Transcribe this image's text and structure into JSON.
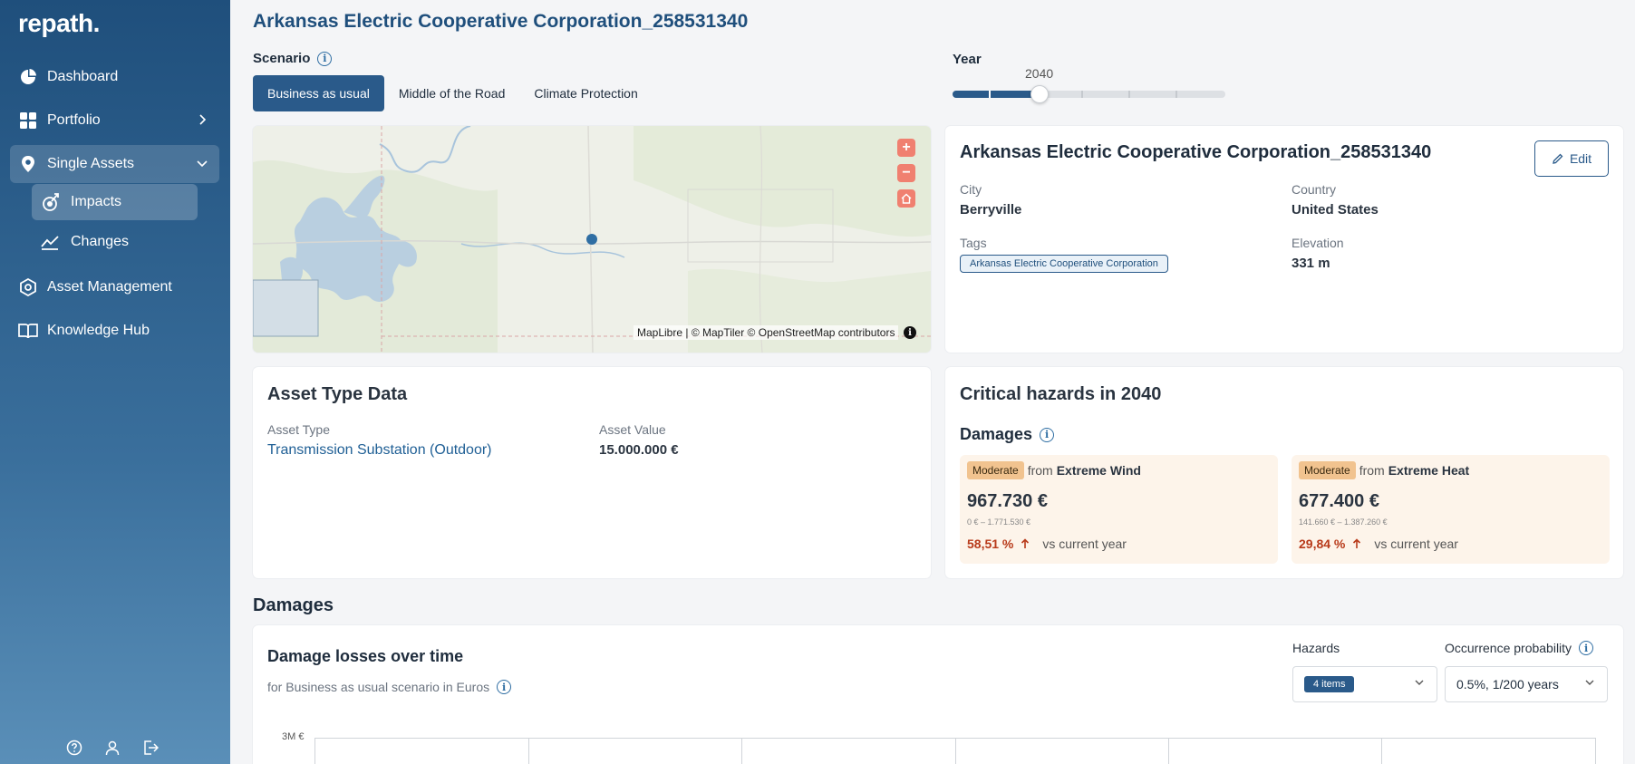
{
  "sidebar": {
    "logo": "repath.",
    "items": [
      {
        "label": "Dashboard"
      },
      {
        "label": "Portfolio"
      },
      {
        "label": "Single Assets"
      },
      {
        "label": "Asset Management"
      },
      {
        "label": "Knowledge Hub"
      }
    ],
    "sub_items": [
      {
        "label": "Impacts"
      },
      {
        "label": "Changes"
      }
    ]
  },
  "page": {
    "title": "Arkansas Electric Cooperative Corporation_258531340"
  },
  "scenario": {
    "label": "Scenario",
    "tabs": [
      "Business as usual",
      "Middle of the Road",
      "Climate Protection"
    ],
    "selected": "Business as usual"
  },
  "year": {
    "label": "Year",
    "value": "2040",
    "position_fraction": 0.32
  },
  "map": {
    "attribution": "MapLibre | © MapTiler © OpenStreetMap contributors",
    "zoom_in": "+",
    "zoom_out": "−"
  },
  "asset": {
    "title": "Arkansas Electric Cooperative Corporation_258531340",
    "edit_label": "Edit",
    "city_label": "City",
    "city": "Berryville",
    "country_label": "Country",
    "country": "United States",
    "tags_label": "Tags",
    "tag": "Arkansas Electric Cooperative Corporation",
    "elevation_label": "Elevation",
    "elevation": "331 m"
  },
  "asset_type_data": {
    "title": "Asset Type Data",
    "type_label": "Asset Type",
    "type_value": "Transmission Substation (Outdoor)",
    "value_label": "Asset Value",
    "value": "15.000.000 €"
  },
  "hazards": {
    "title": "Critical hazards in 2040",
    "damages_label": "Damages",
    "cards": [
      {
        "severity": "Moderate",
        "from": "from",
        "hazard": "Extreme Wind",
        "amount": "967.730 €",
        "range": "0 € – 1.771.530 €",
        "change": "58,51 %",
        "vs": "vs current year"
      },
      {
        "severity": "Moderate",
        "from": "from",
        "hazard": "Extreme Heat",
        "amount": "677.400 €",
        "range": "141.660 € – 1.387.260 €",
        "change": "29,84 %",
        "vs": "vs current year"
      }
    ]
  },
  "damages": {
    "heading": "Damages",
    "chart_title": "Damage losses over time",
    "chart_subtitle": "for Business as usual scenario in Euros",
    "hazards_label": "Hazards",
    "hazards_value": "4 items",
    "occurrence_label": "Occurrence probability",
    "occurrence_value": "0.5%, 1/200 years",
    "y_tick": "3M €"
  },
  "colors": {
    "primary": "#2a5a8a",
    "title_blue": "#1f4f7c",
    "moderate_badge": "#f1c38f",
    "change_red": "#b83a1a"
  }
}
